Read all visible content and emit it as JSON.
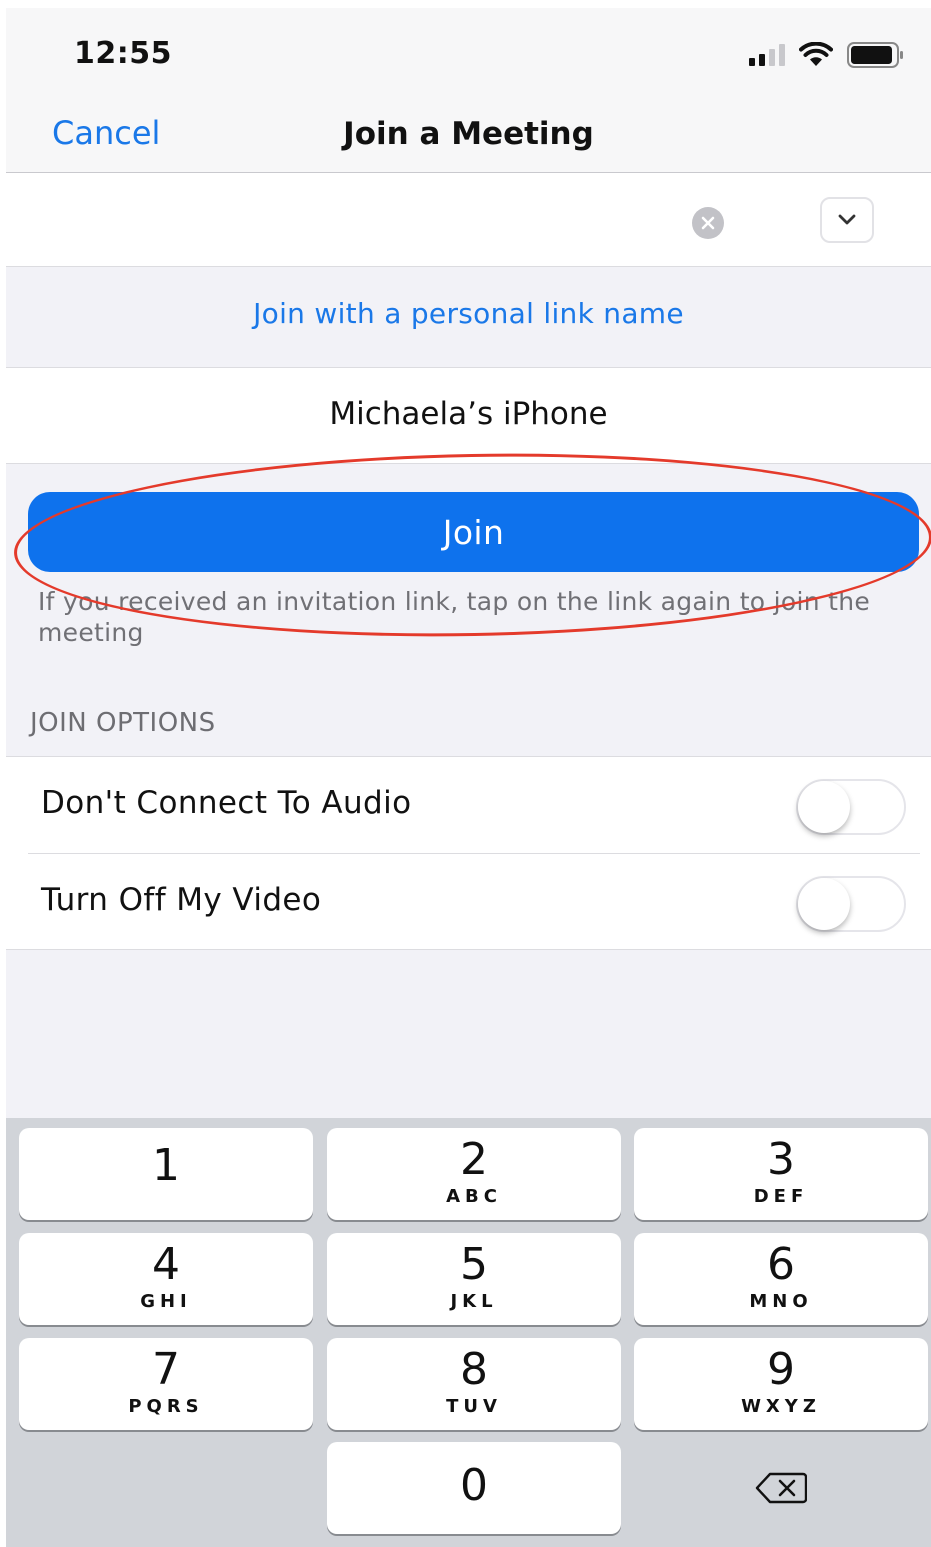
{
  "status_bar": {
    "time": "12:55"
  },
  "navbar": {
    "cancel_label": "Cancel",
    "title": "Join a Meeting"
  },
  "meeting_id": {
    "value": "",
    "placeholder": ""
  },
  "personal_link": {
    "label": "Join with a personal link name"
  },
  "display_name": {
    "value": "Michaela’s iPhone"
  },
  "join": {
    "label": "Join"
  },
  "hint": {
    "text": "If you received an invitation link, tap on the link again to join the meeting"
  },
  "join_options": {
    "header": "JOIN OPTIONS",
    "items": [
      {
        "label": "Don't Connect To Audio",
        "enabled": false
      },
      {
        "label": "Turn Off My Video",
        "enabled": false
      }
    ]
  },
  "keypad": {
    "keys": [
      {
        "num": "1",
        "letters": ""
      },
      {
        "num": "2",
        "letters": "ABC"
      },
      {
        "num": "3",
        "letters": "DEF"
      },
      {
        "num": "4",
        "letters": "GHI"
      },
      {
        "num": "5",
        "letters": "JKL"
      },
      {
        "num": "6",
        "letters": "MNO"
      },
      {
        "num": "7",
        "letters": "PQRS"
      },
      {
        "num": "8",
        "letters": "TUV"
      },
      {
        "num": "9",
        "letters": "WXYZ"
      },
      {
        "num": "0",
        "letters": ""
      }
    ]
  },
  "colors": {
    "accent": "#0e72ed",
    "link": "#1a78e8",
    "annotation": "#e43a2b"
  },
  "icons": {
    "clear": "clear-circle-icon",
    "dropdown": "chevron-down-icon",
    "delete": "backspace-icon",
    "wifi": "wifi-icon",
    "battery": "battery-icon",
    "signal": "signal-icon"
  }
}
